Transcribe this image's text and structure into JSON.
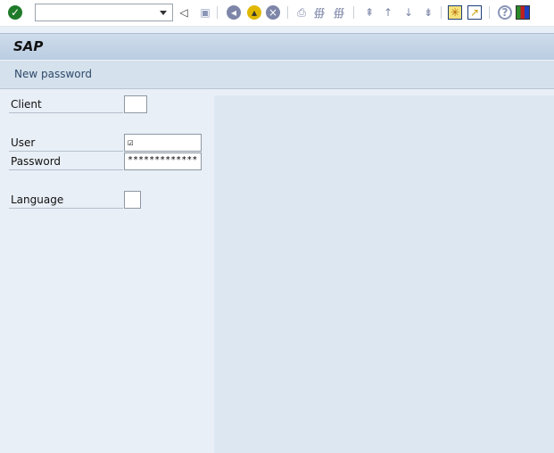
{
  "toolbar": {
    "command_field": "",
    "icons": [
      "enter-icon",
      "back-triangle-icon",
      "save-icon",
      "back-icon",
      "exit-icon",
      "cancel-icon",
      "print-icon",
      "find-icon",
      "find-next-icon",
      "first-page-icon",
      "previous-page-icon",
      "next-page-icon",
      "last-page-icon",
      "create-session-icon",
      "shortcut-icon",
      "help-icon",
      "customize-layout-icon"
    ]
  },
  "title": "SAP",
  "subtitle": "New password",
  "form": {
    "client_label": "Client",
    "client_value": "",
    "user_label": "User",
    "user_value": "☑",
    "password_label": "Password",
    "password_value": "*************",
    "language_label": "Language",
    "language_value": ""
  },
  "colors": {
    "accent": "#b9cde2"
  }
}
